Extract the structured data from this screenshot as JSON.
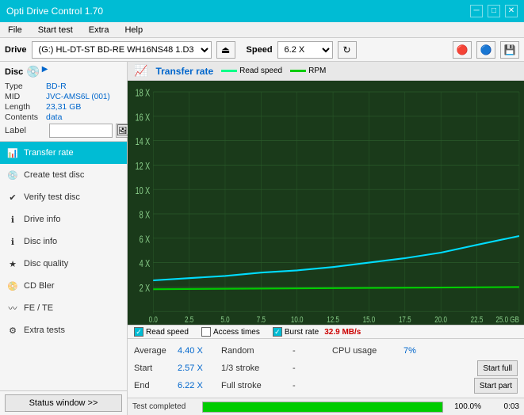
{
  "titleBar": {
    "title": "Opti Drive Control 1.70",
    "minimizeBtn": "─",
    "maximizeBtn": "□",
    "closeBtn": "✕"
  },
  "menuBar": {
    "items": [
      "File",
      "Start test",
      "Extra",
      "Help"
    ]
  },
  "driveToolbar": {
    "driveLabel": "Drive",
    "driveValue": "(G:)  HL-DT-ST BD-RE  WH16NS48 1.D3",
    "speedLabel": "Speed",
    "speedValue": "6.2 X"
  },
  "disc": {
    "header": "Disc",
    "typeLabel": "Type",
    "typeValue": "BD-R",
    "midLabel": "MID",
    "midValue": "JVC-AMS6L (001)",
    "lengthLabel": "Length",
    "lengthValue": "23,31 GB",
    "contentsLabel": "Contents",
    "contentsValue": "data",
    "labelLabel": "Label",
    "labelPlaceholder": ""
  },
  "navItems": [
    {
      "id": "transfer-rate",
      "label": "Transfer rate",
      "active": true
    },
    {
      "id": "create-test-disc",
      "label": "Create test disc",
      "active": false
    },
    {
      "id": "verify-test-disc",
      "label": "Verify test disc",
      "active": false
    },
    {
      "id": "drive-info",
      "label": "Drive info",
      "active": false
    },
    {
      "id": "disc-info",
      "label": "Disc info",
      "active": false
    },
    {
      "id": "disc-quality",
      "label": "Disc quality",
      "active": false
    },
    {
      "id": "cd-bler",
      "label": "CD Bler",
      "active": false
    },
    {
      "id": "fe-te",
      "label": "FE / TE",
      "active": false
    },
    {
      "id": "extra-tests",
      "label": "Extra tests",
      "active": false
    }
  ],
  "statusWindowBtn": "Status window >>",
  "chart": {
    "title": "Transfer rate",
    "legendReadSpeed": "Read speed",
    "legendRPM": "RPM",
    "readSpeedColor": "#00ff88",
    "rpmColor": "#00cc00",
    "yLabels": [
      "18 X",
      "16 X",
      "14 X",
      "12 X",
      "10 X",
      "8 X",
      "6 X",
      "4 X",
      "2 X"
    ],
    "xLabels": [
      "0.0",
      "2.5",
      "5.0",
      "7.5",
      "10.0",
      "12.5",
      "15.0",
      "17.5",
      "20.0",
      "22.5",
      "25.0 GB"
    ]
  },
  "legendsRow": {
    "readSpeedLabel": "Read speed",
    "accessTimesLabel": "Access times",
    "burstRateLabel": "Burst rate",
    "burstRateValue": "32.9 MB/s"
  },
  "stats": {
    "averageLabel": "Average",
    "averageValue": "4.40 X",
    "randomLabel": "Random",
    "randomValue": "-",
    "cpuLabel": "CPU usage",
    "cpuValue": "7%",
    "startLabel": "Start",
    "startValue": "2.57 X",
    "strokeLabel": "1/3 stroke",
    "strokeValue": "-",
    "startFullBtn": "Start full",
    "endLabel": "End",
    "endValue": "6.22 X",
    "fullStrokeLabel": "Full stroke",
    "fullStrokeValue": "-",
    "startPartBtn": "Start part"
  },
  "progress": {
    "label": "Test completed",
    "percentage": "100.0%",
    "time": "0:03",
    "fillWidth": "100"
  }
}
